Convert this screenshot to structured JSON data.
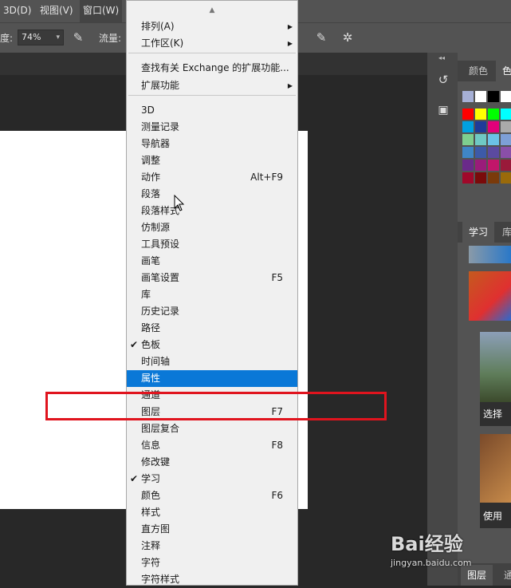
{
  "menubar": {
    "items": [
      "3D(D)",
      "视图(V)",
      "窗口(W)"
    ]
  },
  "options": {
    "opacity_label": "度:",
    "opacity_value": "74%",
    "flow_label": "流量:"
  },
  "right_panel": {
    "tab_color": "颜色",
    "tab_color_partial": "色",
    "tab_learn": "学习",
    "tab_library_partial": "库",
    "learn_card1": "选择",
    "learn_card2": "使用",
    "tab_layers": "图层",
    "tab_channels_partial": "通"
  },
  "menu": {
    "items": [
      {
        "label": "排列(A)",
        "shortcut": "",
        "submenu": true
      },
      {
        "label": "工作区(K)",
        "shortcut": "",
        "submenu": true
      },
      {
        "label": "查找有关 Exchange 的扩展功能...",
        "shortcut": ""
      },
      {
        "label": "扩展功能",
        "shortcut": "",
        "submenu": true
      },
      {
        "label": "3D",
        "shortcut": ""
      },
      {
        "label": "测量记录",
        "shortcut": ""
      },
      {
        "label": "导航器",
        "shortcut": ""
      },
      {
        "label": "调整",
        "shortcut": ""
      },
      {
        "label": "动作",
        "shortcut": "Alt+F9"
      },
      {
        "label": "段落",
        "shortcut": ""
      },
      {
        "label": "段落样式",
        "shortcut": ""
      },
      {
        "label": "仿制源",
        "shortcut": ""
      },
      {
        "label": "工具预设",
        "shortcut": ""
      },
      {
        "label": "画笔",
        "shortcut": ""
      },
      {
        "label": "画笔设置",
        "shortcut": "F5"
      },
      {
        "label": "库",
        "shortcut": ""
      },
      {
        "label": "历史记录",
        "shortcut": ""
      },
      {
        "label": "路径",
        "shortcut": ""
      },
      {
        "label": "色板",
        "shortcut": "",
        "checked": true
      },
      {
        "label": "时间轴",
        "shortcut": ""
      },
      {
        "label": "属性",
        "shortcut": "",
        "highlighted": true
      },
      {
        "label": "通道",
        "shortcut": ""
      },
      {
        "label": "图层",
        "shortcut": "F7"
      },
      {
        "label": "图层复合",
        "shortcut": ""
      },
      {
        "label": "信息",
        "shortcut": "F8"
      },
      {
        "label": "修改键",
        "shortcut": ""
      },
      {
        "label": "学习",
        "shortcut": "",
        "checked": true
      },
      {
        "label": "颜色",
        "shortcut": "F6"
      },
      {
        "label": "样式",
        "shortcut": ""
      },
      {
        "label": "直方图",
        "shortcut": ""
      },
      {
        "label": "注释",
        "shortcut": ""
      },
      {
        "label": "字符",
        "shortcut": ""
      },
      {
        "label": "字符样式",
        "shortcut": ""
      }
    ]
  },
  "watermark": {
    "brand": "Bai经验",
    "url": "jingyan.baidu.com"
  },
  "colors": {
    "highlight": "#0a78d7",
    "annotation_box": "#e0141e"
  }
}
